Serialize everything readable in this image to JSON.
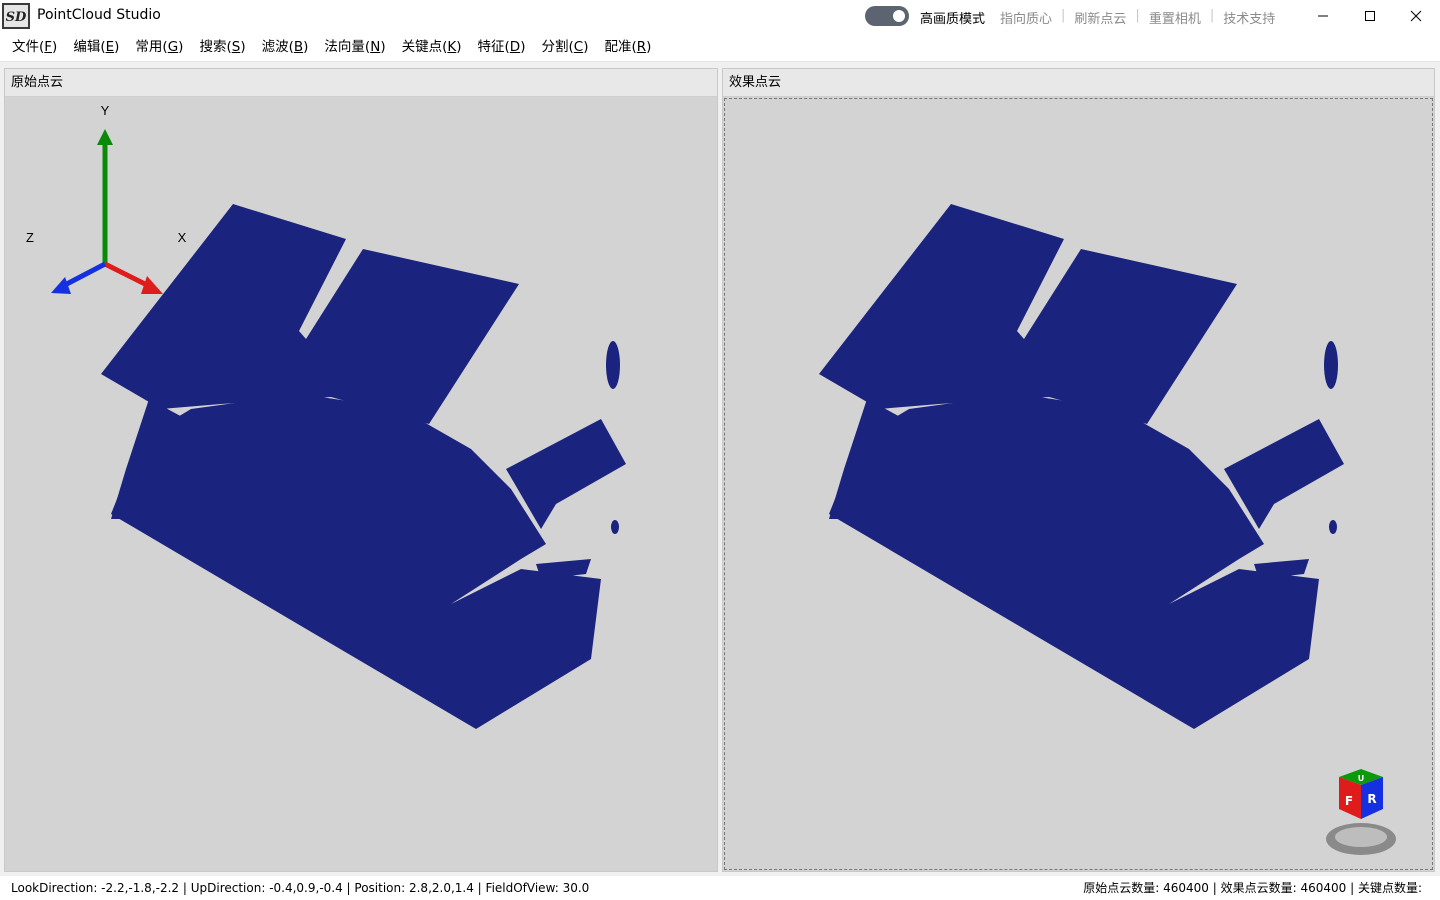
{
  "window": {
    "title": "PointCloud Studio",
    "logo_text": "SD",
    "hq_mode_label": "高画质模式",
    "hq_mode_on": true,
    "actions": [
      "指向质心",
      "刷新点云",
      "重置相机",
      "技术支持"
    ],
    "controls": {
      "minimize": "—",
      "maximize": "☐",
      "close": "✕"
    }
  },
  "menu": [
    {
      "label": "文件(",
      "key": "F",
      "end": ")"
    },
    {
      "label": "编辑(",
      "key": "E",
      "end": ")"
    },
    {
      "label": "常用(",
      "key": "G",
      "end": ")"
    },
    {
      "label": "搜索(",
      "key": "S",
      "end": ")"
    },
    {
      "label": "滤波(",
      "key": "B",
      "end": ")"
    },
    {
      "label": "法向量(",
      "key": "N",
      "end": ")"
    },
    {
      "label": "关键点(",
      "key": "K",
      "end": ")"
    },
    {
      "label": "特征(",
      "key": "D",
      "end": ")"
    },
    {
      "label": "分割(",
      "key": "C",
      "end": ")"
    },
    {
      "label": "配准(",
      "key": "R",
      "end": ")"
    }
  ],
  "panels": {
    "left_title": "原始点云",
    "right_title": "效果点云",
    "axes": {
      "x": "X",
      "y": "Y",
      "z": "Z"
    },
    "view_cube": {
      "front": "F",
      "right": "R",
      "top": "U"
    }
  },
  "colors": {
    "point_cloud": "#1a237e",
    "viewport_bg": "#d3d3d3",
    "axis_x": "#e01b1b",
    "axis_y": "#0a8a0a",
    "axis_z": "#1530e0"
  },
  "status": {
    "camera": "LookDirection: -2.2,-1.8,-2.2 | UpDirection: -0.4,0.9,-0.4 | Position: 2.8,2.0,1.4 | FieldOfView: 30.0",
    "counts": "原始点云数量:  460400 | 效果点云数量:  460400 | 关键点数量:"
  }
}
